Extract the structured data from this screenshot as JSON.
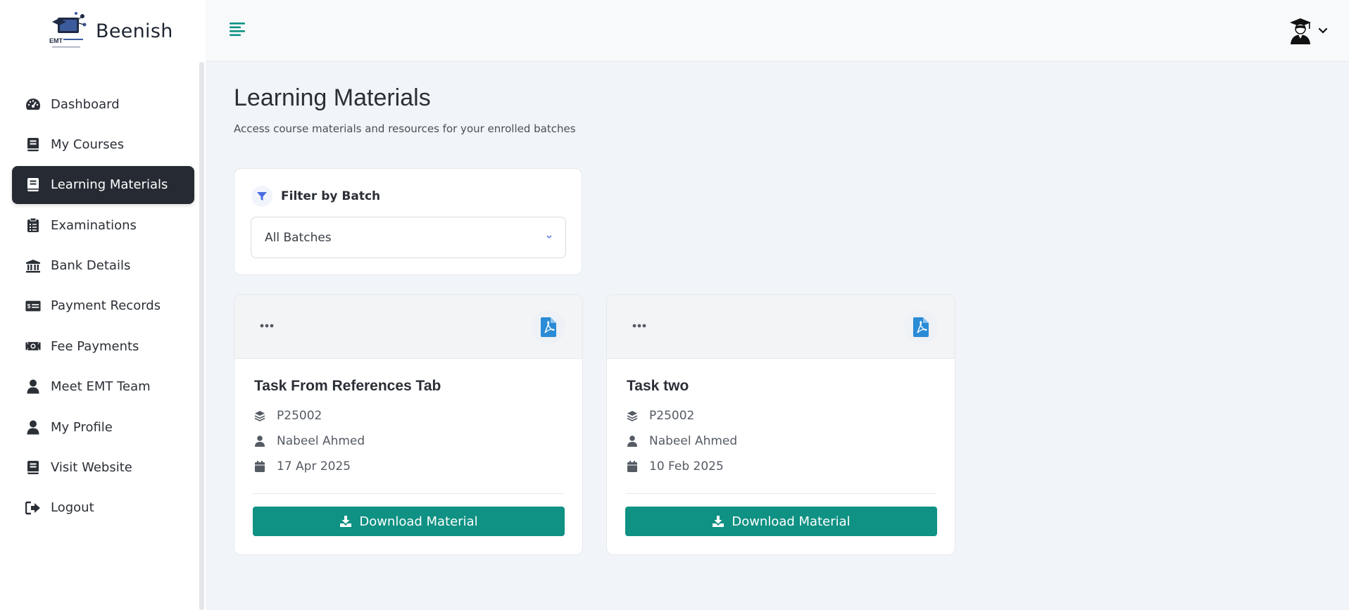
{
  "brand": {
    "name": "Beenish",
    "logo_text": "EMT",
    "logo_icon": "emt-logo-icon"
  },
  "colors": {
    "accent": "#0f9183",
    "active_nav": "#262b33",
    "pdf": "#2a8bd6",
    "filter_icon": "#4a6ee0"
  },
  "sidebar": {
    "items": [
      {
        "label": "Dashboard",
        "icon": "gauge-icon",
        "active": false
      },
      {
        "label": "My Courses",
        "icon": "book-icon",
        "active": false
      },
      {
        "label": "Learning Materials",
        "icon": "book-icon",
        "active": true
      },
      {
        "label": "Examinations",
        "icon": "clipboard-icon",
        "active": false
      },
      {
        "label": "Bank Details",
        "icon": "bank-icon",
        "active": false
      },
      {
        "label": "Payment Records",
        "icon": "money-check-icon",
        "active": false
      },
      {
        "label": "Fee Payments",
        "icon": "money-bill-icon",
        "active": false
      },
      {
        "label": "Meet EMT Team",
        "icon": "user-icon",
        "active": false
      },
      {
        "label": "My Profile",
        "icon": "user-icon",
        "active": false
      },
      {
        "label": "Visit Website",
        "icon": "book-icon",
        "active": false
      },
      {
        "label": "Logout",
        "icon": "sign-out-icon",
        "active": false
      }
    ]
  },
  "header": {
    "menu_icon": "align-left-icon",
    "avatar_icon": "graduate-avatar-icon"
  },
  "main": {
    "title": "Learning Materials",
    "subtitle": "Access course materials and resources for your enrolled batches",
    "filter": {
      "label": "Filter by Batch",
      "selected": "All Batches"
    }
  },
  "materials": [
    {
      "title": "Task From References Tab",
      "batch": "P25002",
      "instructor": "Nabeel Ahmed",
      "date": "17 Apr 2025",
      "button": "Download Material"
    },
    {
      "title": "Task two",
      "batch": "P25002",
      "instructor": "Nabeel Ahmed",
      "date": "10 Feb 2025",
      "button": "Download Material"
    }
  ]
}
